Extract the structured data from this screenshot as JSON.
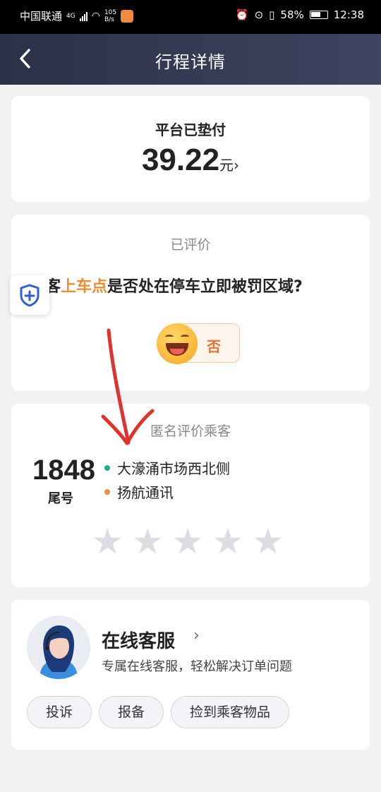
{
  "status_bar": {
    "carrier": "中国联通",
    "network_type": "4G",
    "speed_value": "105",
    "speed_unit": "B/s",
    "battery": "58%",
    "time": "12:38"
  },
  "nav": {
    "back_icon": "chevron-left-icon",
    "title": "行程详情"
  },
  "payment": {
    "label": "平台已垫付",
    "amount": "39.22",
    "unit": "元",
    "chevron": "›"
  },
  "evaluation": {
    "status": "已评价",
    "question_prefix": "客",
    "question_highlight": "上车点",
    "question_suffix": "是否处在停车立即被罚区域?",
    "answer": "否",
    "highlight_color": "#f08c2c"
  },
  "anonymous_rating": {
    "title": "匿名评价乘客",
    "tail_number": "1848",
    "tail_label": "尾号",
    "pickup": "大濠涌市场西北侧",
    "dropoff": "扬航通讯",
    "pickup_dot_color": "#18b08a",
    "dropoff_dot_color": "#f08c4c",
    "stars": [
      0,
      0,
      0,
      0,
      0
    ],
    "max_stars": 5
  },
  "service": {
    "title": "在线客服",
    "chevron": "›",
    "description": "专属在线客服，轻松解决订单问题",
    "buttons": [
      "投诉",
      "报备",
      "捡到乘客物品"
    ]
  }
}
